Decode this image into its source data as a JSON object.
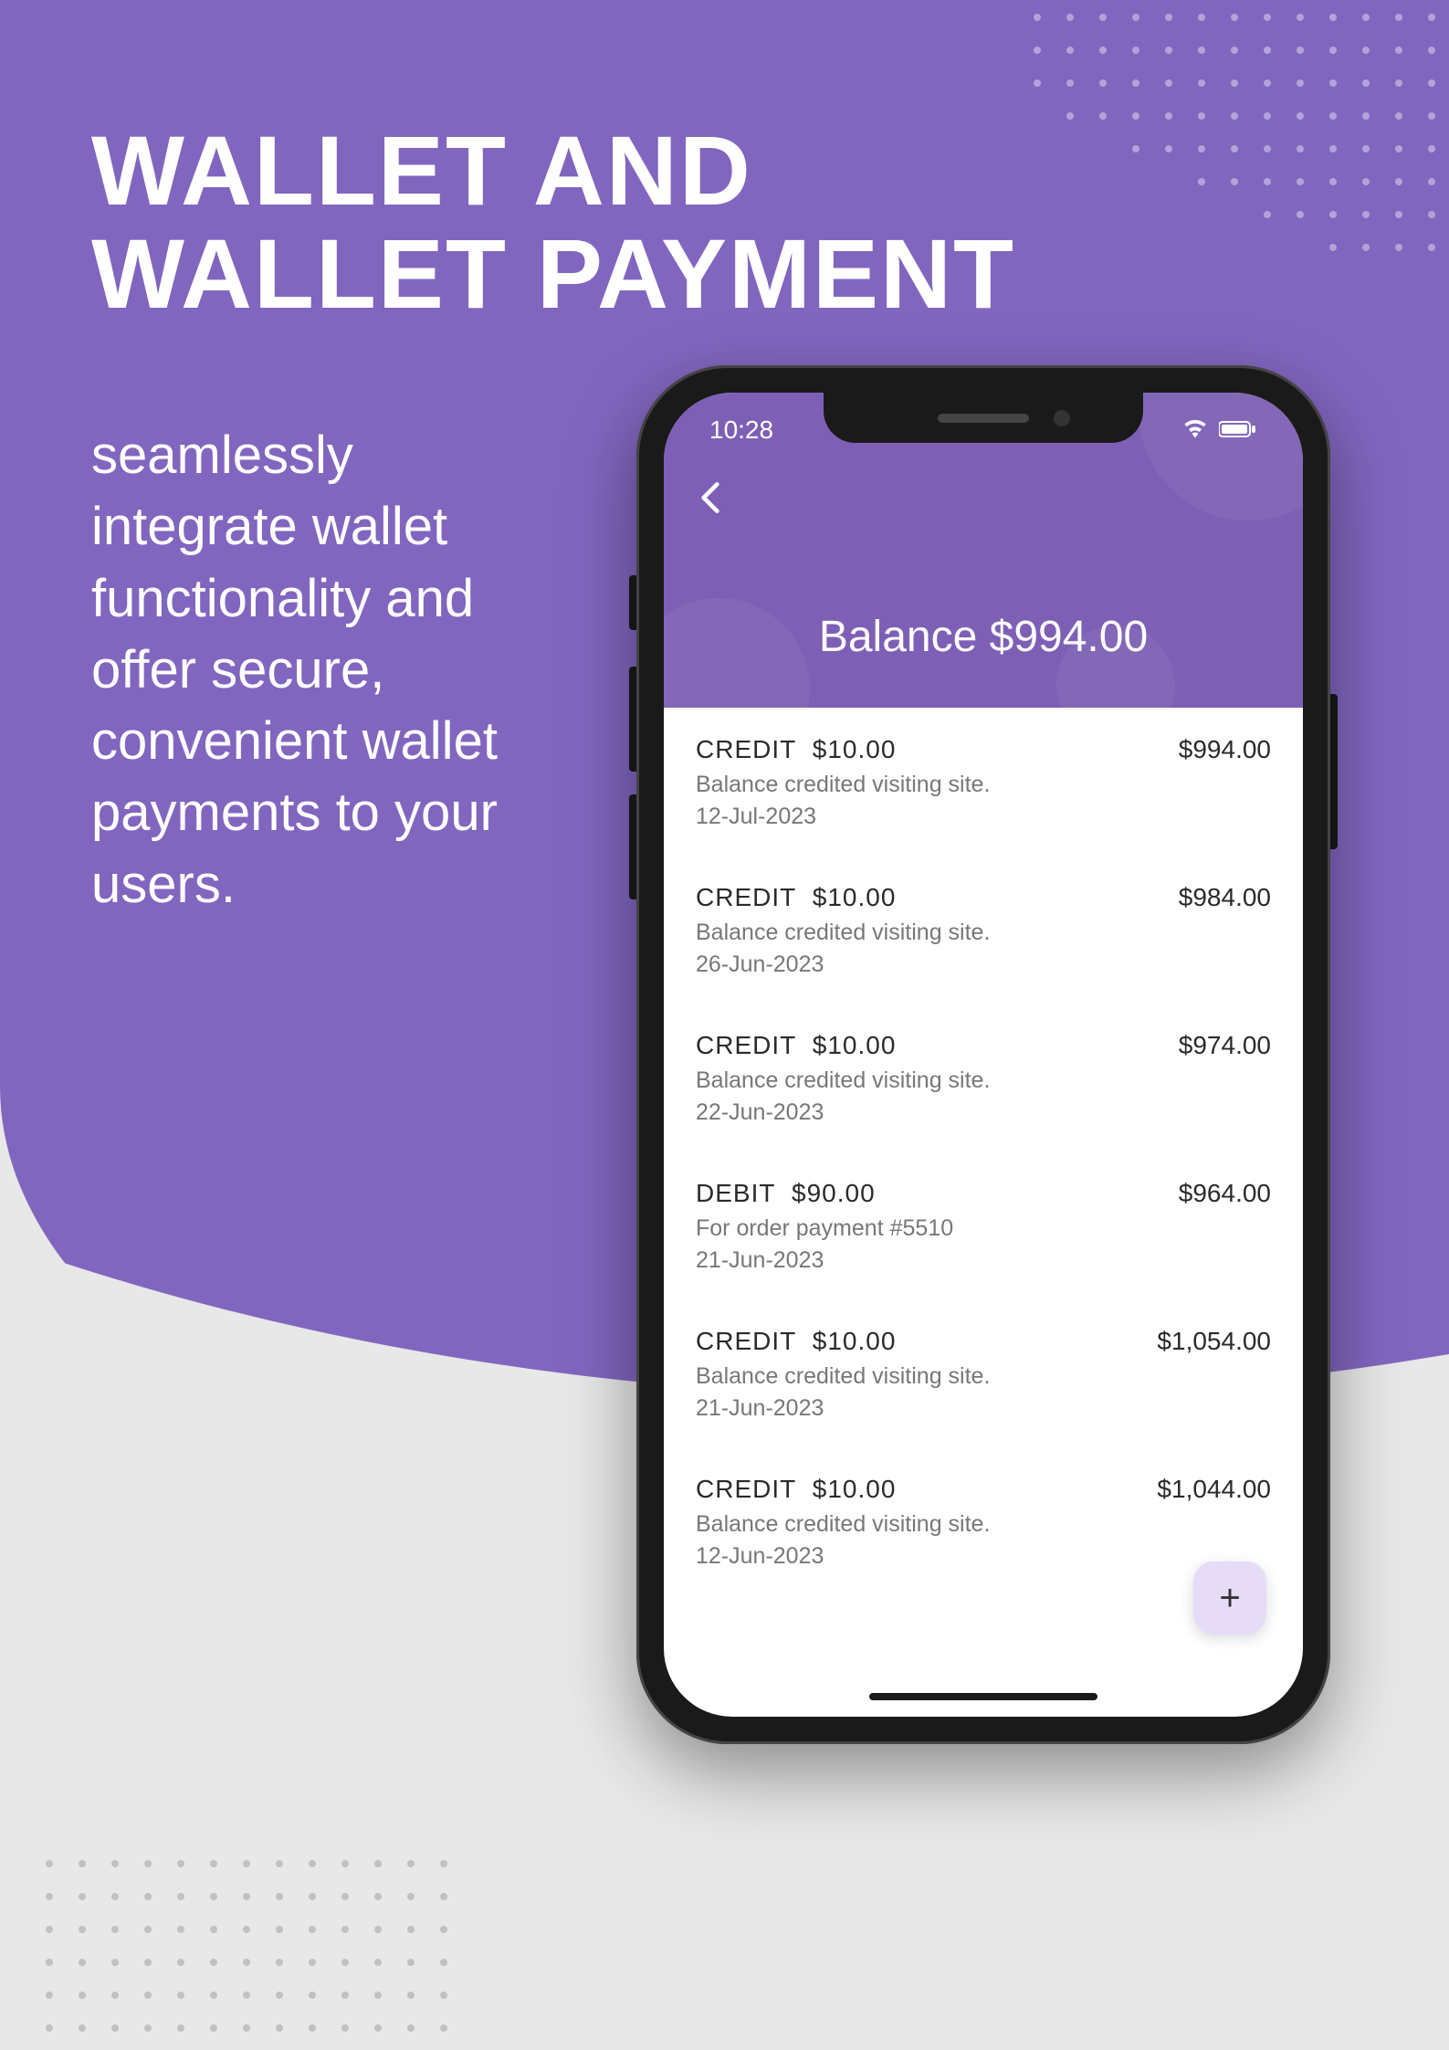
{
  "hero": {
    "title_line1": "WALLET AND",
    "title_line2": "WALLET PAYMENT",
    "subtitle": "seamlessly integrate wallet functionality and offer secure, convenient wallet payments to your users."
  },
  "app": {
    "status_time": "10:28",
    "balance_label": "Balance $994.00",
    "fab_label": "+",
    "transactions": [
      {
        "type": "CREDIT",
        "amount": "$10.00",
        "desc": "Balance credited visiting site.",
        "date": "12-Jul-2023",
        "running": "$994.00"
      },
      {
        "type": "CREDIT",
        "amount": "$10.00",
        "desc": "Balance credited visiting site.",
        "date": "26-Jun-2023",
        "running": "$984.00"
      },
      {
        "type": "CREDIT",
        "amount": "$10.00",
        "desc": "Balance credited visiting site.",
        "date": "22-Jun-2023",
        "running": "$974.00"
      },
      {
        "type": "DEBIT",
        "amount": "$90.00",
        "desc": "For order payment #5510",
        "date": "21-Jun-2023",
        "running": "$964.00"
      },
      {
        "type": "CREDIT",
        "amount": "$10.00",
        "desc": "Balance credited visiting site.",
        "date": "21-Jun-2023",
        "running": "$1,054.00"
      },
      {
        "type": "CREDIT",
        "amount": "$10.00",
        "desc": "Balance credited visiting site.",
        "date": "12-Jun-2023",
        "running": "$1,044.00"
      }
    ]
  }
}
